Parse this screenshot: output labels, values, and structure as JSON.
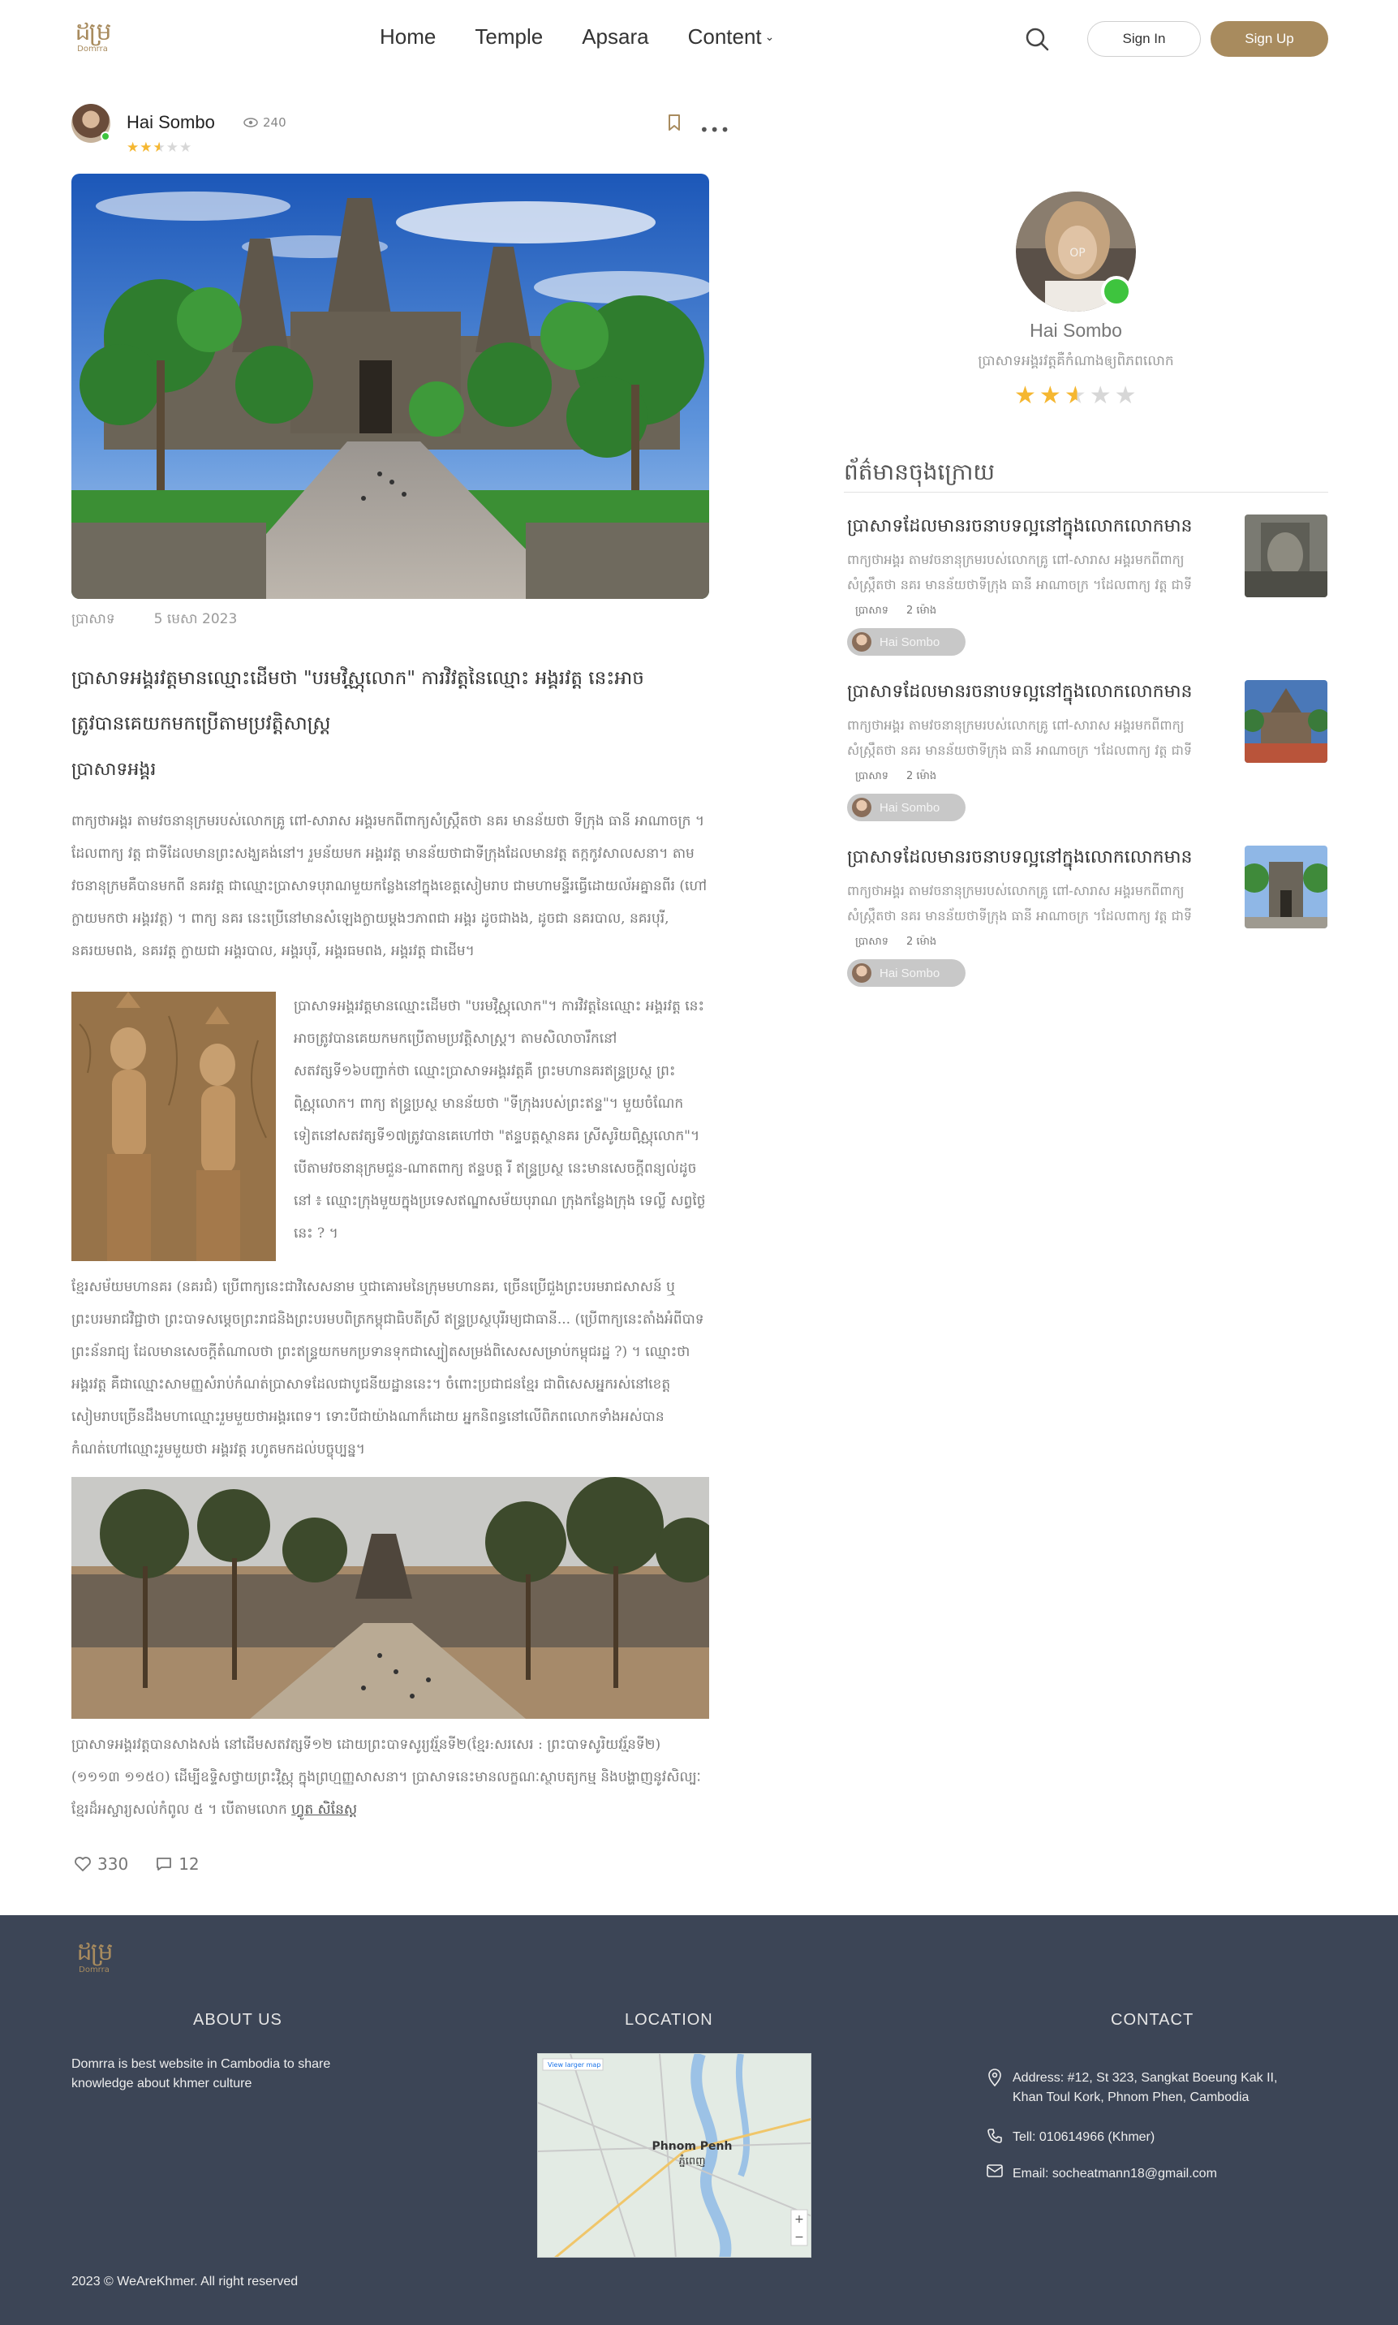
{
  "header": {
    "logo_glyph": "ដម្រ",
    "logo_text": "Domrra",
    "nav": [
      {
        "label": "Home"
      },
      {
        "label": "Temple"
      },
      {
        "label": "Apsara"
      },
      {
        "label": "Content"
      }
    ],
    "signin_label": "Sign In",
    "signup_label": "Sign Up",
    "accent_color": "#a88b5e"
  },
  "post": {
    "author_name": "Hai Sombo",
    "views": "240",
    "rating": 2.5,
    "rating_max": 5,
    "category": "ប្រាសាទ",
    "date": "5 មេសា 2023",
    "title": "ប្រាសាទអង្គរវត្តមានឈ្មោះដើមថា \"បរមវិស្ណុលោក\" ការវិវត្តនៃឈ្មោះ អង្គរវត្ត នេះអាចត្រូវបានគេយកមកប្រើតាមប្រវត្តិសាស្ត្រ",
    "subtitle": "ប្រាសាទអង្គរ",
    "para1": "ពាក្យថាអង្គរ តាមវចនានុក្រមរបស់លោកគ្រូ ពៅ-សារាស អង្គរមកពីពាក្យសំស្ក្រឹតថា នគរ មានន័យថា ទីក្រុង ធានី អាណាចក្រ ។ ដែលពាក្យ វត្ត ជាទីដែលមានព្រះសង្ឃគង់នៅ។ រួមន័យមក អង្គរវត្ត មានន័យថាជាទីក្រុងដែលមានវត្ត តក្កកូវសាលសនា។ តាមវចនានុក្រមគឺបានមកពី នគរវត្ត ជាឈ្មោះប្រាសាទបុរាណមួយកន្លែងនៅក្នុងខេត្តសៀមរាប ជាមហាមន្ទីរធ្វើដោយល័អគ្នានពីរ (ហៅក្លាយមកថា អង្គរវត្ត) ។ ពាក្យ នគរ នេះប្រើនៅមានសំឡេងក្លាយម្ដងៗភាពជា អង្គរ ដូចជាងង, ដូចជា នគរបាល, នគរបុរី, នគរយមពង, នគរវត្ត ក្លាយជា អង្គរបាល, អង្គរបុរី, អង្គរធមពង, អង្គរវត្ត ជាដើម។",
    "para2": "ប្រាសាទអង្គរវត្តមានឈ្មោះដើមថា \"បរមវិស្ណុលោក\"។ ការវិវត្តនៃឈ្មោះ អង្គរវត្ត នេះអាចត្រូវបានគេយកមកប្រើតាមប្រវត្តិសាស្ត្រ។ តាមសិលាចារឹកនៅសតវត្សទី១៦បញ្ជាក់ថា ឈ្មោះប្រាសាទអង្គរវត្តគឺ ព្រះមហានគរឥន្ទ្រប្រស្ថ ព្រះពិស្ណុលោក។ ពាក្យ ឥន្ទ្រប្រស្ថ មានន័យថា \"ទីក្រុងរបស់ព្រះឥន្ទ\"។ មួយចំណែកទៀតនៅសតវត្សទី១៧ត្រូវបានគេហៅថា \"ឥន្ទបត្តស្ថានគរ ស្រីសូរិយពិស្ណុលោក\"។ បើតាមវចនានុក្រមជួន-ណាតពាក្យ ឥន្ទបត្ត រី ឥន្ទ្រប្រស្ថ នេះមានសេចក្តីពន្យល់ដូចនៅ ៖ ឈ្មោះក្រុងមួយក្នុងប្រទេសឥណ្ឌាសម័យបុរាណ ក្រុងកន្លែងក្រុង ទេល្លី សព្វថ្ងៃនេះ ? ។",
    "para3": "ខ្មែរសម័យមហានគរ (នគរជំ) ប្រើពាក្យនេះជាវិសេសនាម ឬជាគោរមនៃក្រុមមហានគរ, ច្រើនប្រើជួងព្រះបរមរាជសាសន៍ ឬព្រះបរមរាជវិជ្ជាថា ព្រះបាទសម្ដេចព្រះរាជនិងព្រះបរមបពិត្រកម្ពុជាធិបតីស្រី ឥន្ទ្រប្រស្ថបុរីរម្យជាធានី... (ប្រើពាក្យនេះតាំងអំពីបាទព្រះន័នរាជ្យ ដែលមានសេចក្តីតំណាលថា ព្រះឥន្ទ្រយកមកប្រទានទុកជាស្បៀតសម្រង់ពិសេសសម្រាប់កម្ពុជរដ្ឋ ?) ។ ឈ្មោះថា អង្គរវត្ត គឺជាឈ្មោះសាមញ្ញសំរាប់កំណត់ប្រាសាទដែលជាបូជនីយដ្ឋាននេះ។ ចំពោះប្រជាជនខ្មែរ ជាពិសេសអ្នករស់នៅខេត្តសៀមរាបច្រើនដឹងមហាឈ្មោះរួមមួយថាអង្គរពេទ។ ទោះបីជាយ៉ាងណាក៏ដោយ អ្នកនិពន្ធនៅលើពិភពលោកទាំងអស់បានកំណត់ហៅឈ្មោះរួមមួយថា អង្គរវត្ត រហូតមកដល់បច្ចុប្បន្ន។",
    "para4": "ប្រាសាទអង្គរវត្តបានសាងសង់ នៅដើមសតវត្សទី១២ ដោយព្រះបាទសូរ្យវរ្ម័នទី២(ខ្មែរ:សរសេរ : ព្រះបាទសូរិយវរ្ម័នទី២) (១១១៣ ១១៥០) ដើម្បីឧទ្ទិសថ្វាយព្រះវិស្ណុ ក្នុងព្រហ្មញ្ញសាសនា។ ប្រាសាទនេះមានលក្ខណៈស្ថាបត្យកម្ម និងបង្ហាញនូវសិល្បៈខ្មែរដ៏អស្ចារ្យសល់កំពូល ៥ ។ បើតាមលោក",
    "para4_link": "ហ្វូត សិនែស្ដ",
    "likes": "330",
    "comments": "12"
  },
  "sidebar": {
    "profile_name": "Hai Sombo",
    "profile_bio": "ប្រាសាទអង្គរវត្តគឺកំណាងឲ្យពិភពលោក",
    "profile_rating": 2.5,
    "avatar_overlay_text": "OP",
    "recent_title": "ព័ត៌មានចុងក្រោយ",
    "recent": [
      {
        "title": "ប្រាសាទដែលមានរចនាបទល្អនៅក្នុងលោកលោកមាន",
        "desc": "ពាក្យថាអង្គរ តាមវចនានុក្រមរបស់លោកគ្រូ ពៅ-សារាស អង្គរមកពីពាក្យសំស្ក្រឹតថា នគរ មានន័យថាទីក្រុង ធានី អាណាចក្រ ។ដែលពាក្យ វត្ត ជាទី",
        "category": "ប្រាសាទ",
        "time": "2 ម៉ោង",
        "author": "Hai Sombo"
      },
      {
        "title": "ប្រាសាទដែលមានរចនាបទល្អនៅក្នុងលោកលោកមាន",
        "desc": "ពាក្យថាអង្គរ តាមវចនានុក្រមរបស់លោកគ្រូ ពៅ-សារាស អង្គរមកពីពាក្យសំស្ក្រឹតថា នគរ មានន័យថាទីក្រុង ធានី អាណាចក្រ ។ដែលពាក្យ វត្ត ជាទី",
        "category": "ប្រាសាទ",
        "time": "2 ម៉ោង",
        "author": "Hai Sombo"
      },
      {
        "title": "ប្រាសាទដែលមានរចនាបទល្អនៅក្នុងលោកលោកមាន",
        "desc": "ពាក្យថាអង្គរ តាមវចនានុក្រមរបស់លោកគ្រូ ពៅ-សារាស អង្គរមកពីពាក្យសំស្ក្រឹតថា នគរ មានន័យថាទីក្រុង ធានី អាណាចក្រ ។ដែលពាក្យ វត្ត ជាទី",
        "category": "ប្រាសាទ",
        "time": "2 ម៉ោង",
        "author": "Hai Sombo"
      }
    ]
  },
  "footer": {
    "logo_glyph": "ដម្រ",
    "logo_text": "Domrra",
    "about_title": "ABOUT US",
    "about_text": "Domrra is best website in Cambodia to share knowledge about khmer culture",
    "location_title": "LOCATION",
    "map_link": "View larger map",
    "map_city": "Phnom Penh",
    "map_city_kh": "ភ្នំពេញ",
    "map_zoom_in": "+",
    "map_zoom_out": "−",
    "contact_title": "CONTACT",
    "address": "Address: #12, St 323, Sangkat Boeung Kak II, Khan Toul Kork, Phnom Phen, Cambodia",
    "phone": "Tell: 010614966 (Khmer)",
    "email": "Email: socheatmann18@gmail.com",
    "copyright": "2023 © WeAreKhmer. All right reserved",
    "background": "#3c4556"
  }
}
